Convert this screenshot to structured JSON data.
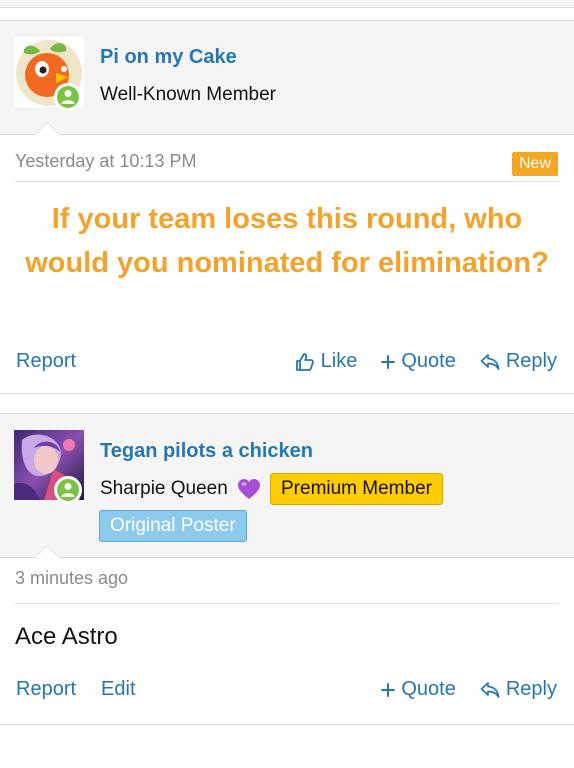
{
  "posts": [
    {
      "username": "Pi on my Cake",
      "user_title": "Well-Known Member",
      "avatar_icon": "orange-bird-avatar",
      "online_icon": "user-online-icon",
      "timestamp": "Yesterday at 10:13 PM",
      "new_badge": "New",
      "message": "If your team loses this round, who would you nominated for elimination?",
      "message_color": "#f6a22a",
      "actions_left": [
        "Report"
      ],
      "actions_right": {
        "like": "Like",
        "quote": "Quote",
        "reply": "Reply"
      }
    },
    {
      "username": "Tegan pilots a chicken",
      "user_title": "Sharpie Queen",
      "title_emoji_icon": "purple-heart-icon",
      "premium_badge": "Premium Member",
      "op_badge": "Original Poster",
      "avatar_icon": "character-avatar",
      "online_icon": "user-online-icon",
      "timestamp": "3 minutes ago",
      "message": "Ace Astro",
      "actions_left": [
        "Report",
        "Edit"
      ],
      "actions_right": {
        "quote": "Quote",
        "reply": "Reply"
      }
    }
  ],
  "colors": {
    "link": "#2577b1",
    "online": "#7cc243",
    "new_badge": "#f5a623",
    "premium_badge": "#ffcc00",
    "op_badge": "#8ccbeb"
  }
}
